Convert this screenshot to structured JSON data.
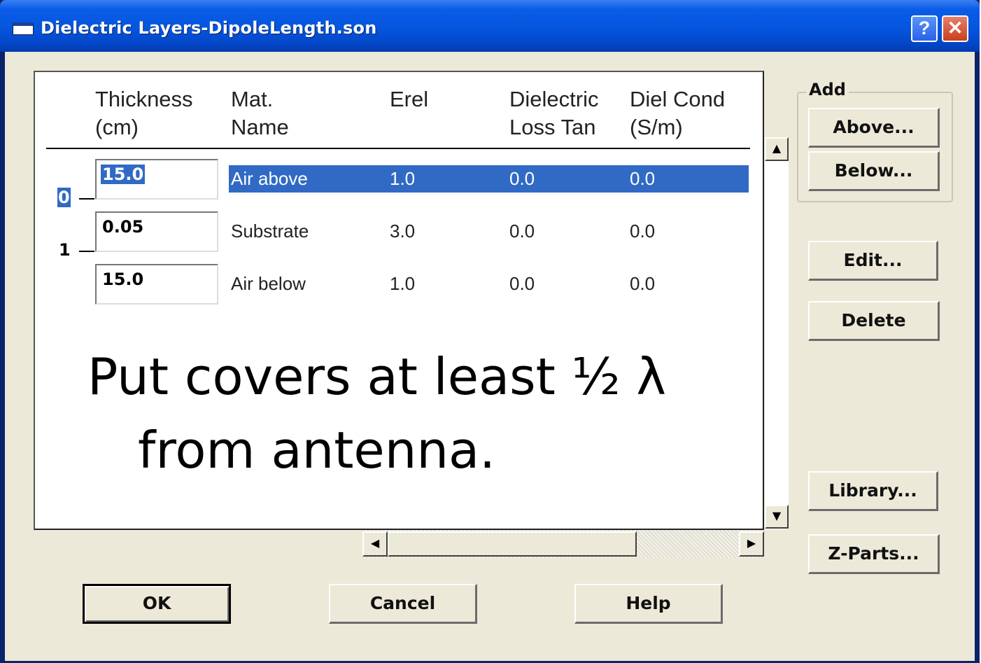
{
  "window": {
    "title": "Dielectric Layers-DipoleLength.son",
    "help_label": "?",
    "close_label": "✕"
  },
  "table": {
    "headers": [
      {
        "line1": "Thickness",
        "line2": "(cm)"
      },
      {
        "line1": "Mat.",
        "line2": "Name"
      },
      {
        "line1": "Erel",
        "line2": ""
      },
      {
        "line1": "Dielectric",
        "line2": "Loss Tan"
      },
      {
        "line1": "Diel Cond",
        "line2": "(S/m)"
      }
    ],
    "rows": [
      {
        "thickness": "15.0",
        "name": "Air above",
        "erel": "1.0",
        "loss_tan": "0.0",
        "cond": "0.0",
        "selected": true
      },
      {
        "thickness": "0.05",
        "name": "Substrate",
        "erel": "3.0",
        "loss_tan": "0.0",
        "cond": "0.0",
        "selected": false
      },
      {
        "thickness": "15.0",
        "name": "Air below",
        "erel": "1.0",
        "loss_tan": "0.0",
        "cond": "0.0",
        "selected": false
      }
    ],
    "levels": [
      "0",
      "1"
    ]
  },
  "annotation": {
    "line1": "Put covers at least ½ λ",
    "line2": "from antenna."
  },
  "scroll": {
    "up": "▲",
    "down": "▼",
    "left": "◀",
    "right": "▶"
  },
  "add_group": {
    "label": "Add",
    "above": "Above...",
    "below": "Below..."
  },
  "side_buttons": {
    "edit": "Edit...",
    "delete": "Delete",
    "library": "Library...",
    "zparts": "Z-Parts..."
  },
  "footer": {
    "ok": "OK",
    "cancel": "Cancel",
    "help": "Help"
  },
  "colors": {
    "titlebar": "#0555dd",
    "face": "#ece9d8",
    "selection": "#316ac5"
  }
}
